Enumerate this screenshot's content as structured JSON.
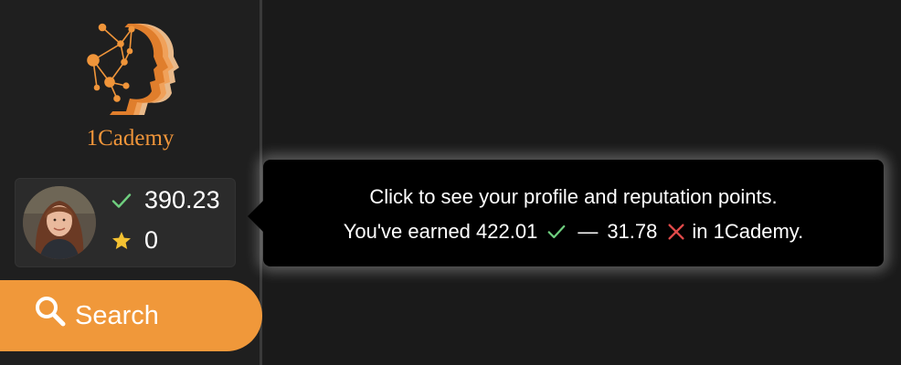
{
  "brand": {
    "name": "1Cademy",
    "color": "#f0953a"
  },
  "profile": {
    "reputation": "390.23",
    "stars": "0",
    "icons": {
      "reputation": "check-icon",
      "stars": "star-icon"
    }
  },
  "search": {
    "label": "Search",
    "icon": "search-icon",
    "color": "#f0983a"
  },
  "tooltip": {
    "line1": "Click to see your profile and reputation points.",
    "line2_prefix": "You've earned 422.01",
    "dash": "—",
    "negative_value": "31.78",
    "line2_suffix": "in 1Cademy.",
    "icons": {
      "positive": "check-icon",
      "negative": "cross-icon"
    }
  },
  "colors": {
    "check": "#6fcf7f",
    "cross": "#e04a4a",
    "star": "#f5c232"
  }
}
